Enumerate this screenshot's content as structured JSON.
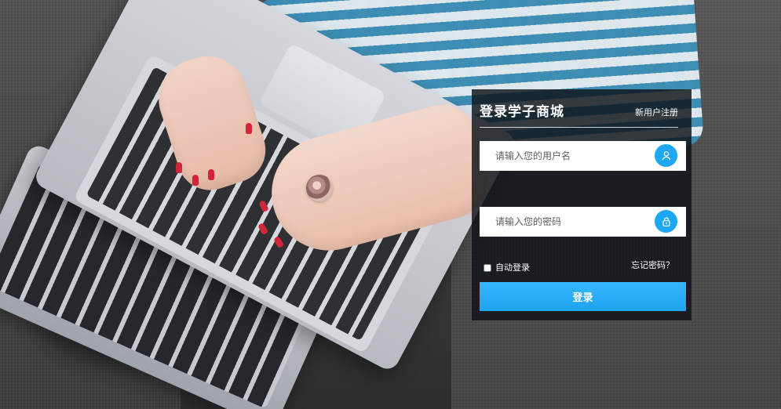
{
  "colors": {
    "panel_bg": "#11161C",
    "accent": "#1DA3F0",
    "text_primary": "#FFFFFF"
  },
  "login": {
    "title": "登录学子商城",
    "register_link": "新用户注册",
    "username": {
      "value": "",
      "placeholder": "请输入您的用户名",
      "icon": "user-icon"
    },
    "password": {
      "value": "",
      "placeholder": "请输入您的密码",
      "icon": "lock-icon"
    },
    "remember_label": "自动登录",
    "forgot_password": "忘记密码？",
    "submit_label": "登录"
  }
}
